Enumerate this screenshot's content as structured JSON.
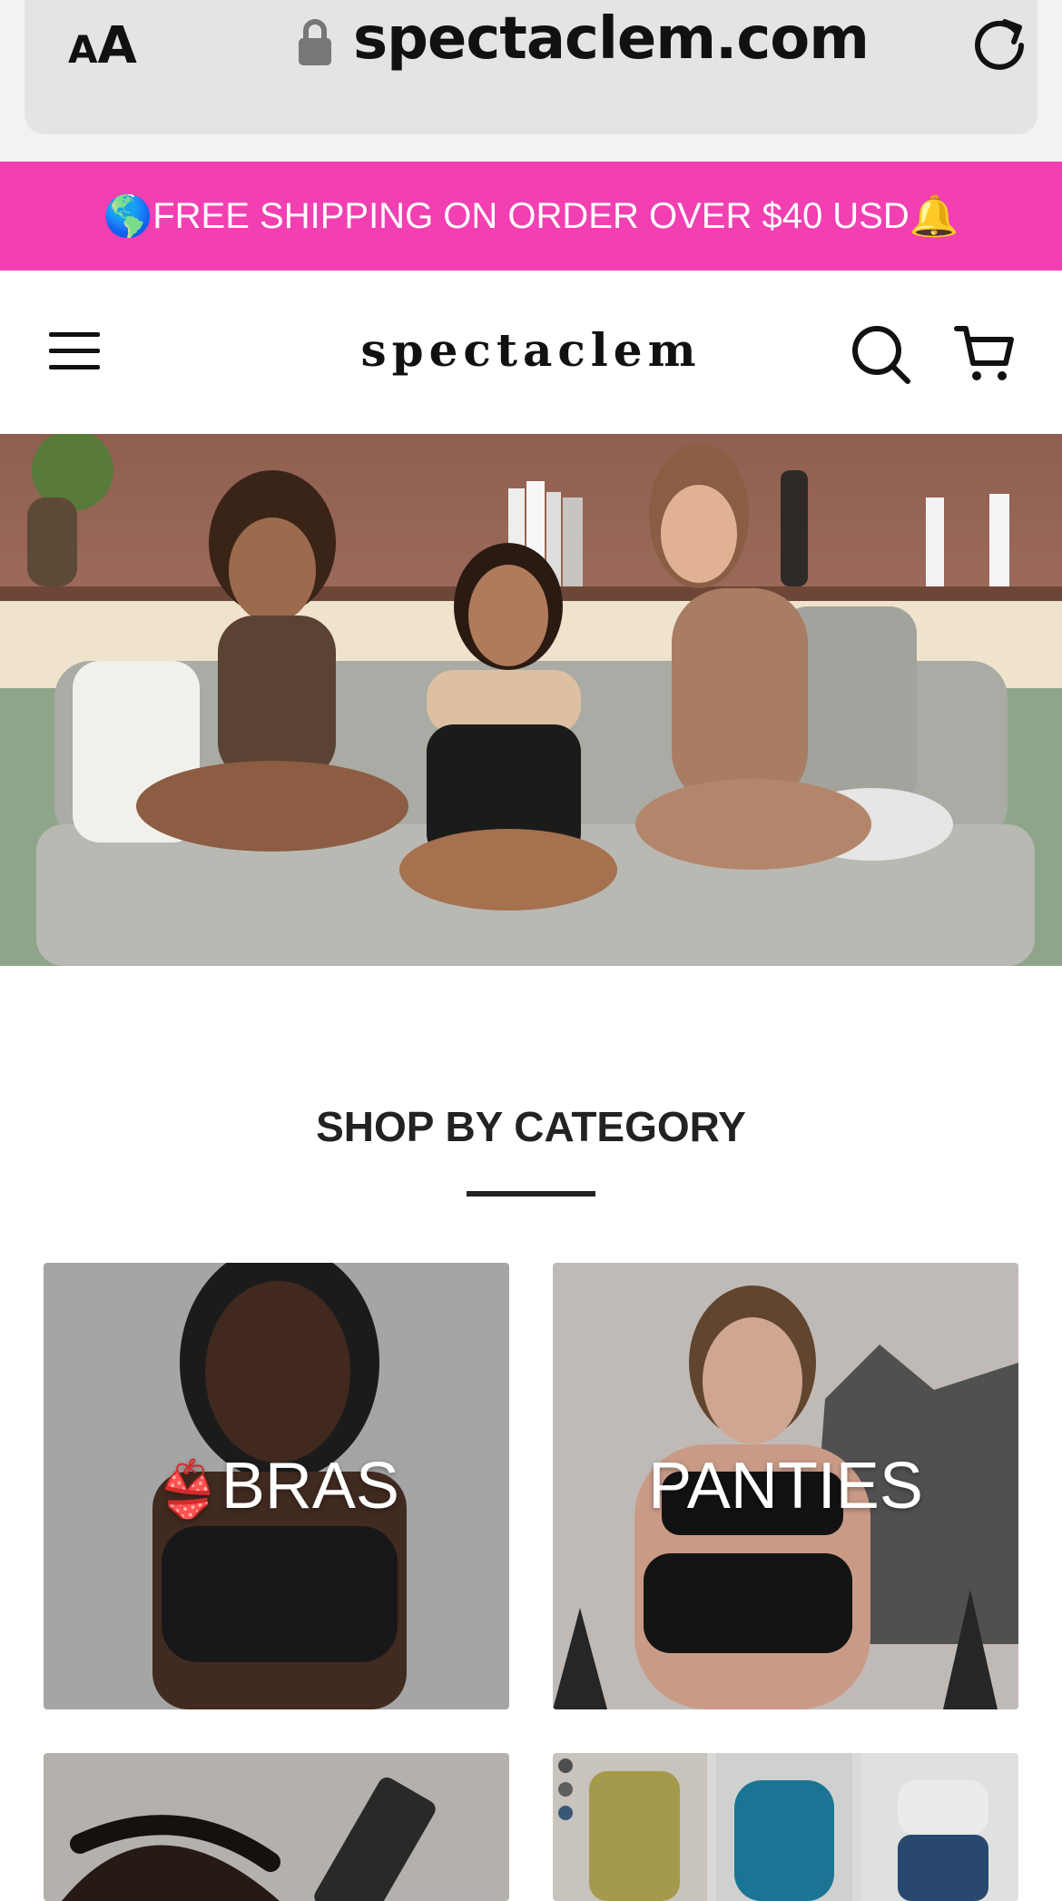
{
  "browser": {
    "text_size_label_small": "A",
    "text_size_label_big": "A",
    "url": "spectaclem.com"
  },
  "promo": {
    "text": "FREE SHIPPING ON ORDER OVER $40 USD",
    "emoji_left": "🌎",
    "emoji_right": "🔔",
    "background": "#f23fb2"
  },
  "header": {
    "logo": "spectaclem",
    "icons": [
      "menu-icon",
      "search-icon",
      "cart-icon"
    ]
  },
  "section": {
    "title": "SHOP BY CATEGORY"
  },
  "categories": [
    {
      "label": "BRAS",
      "emoji": "👙"
    },
    {
      "label": "PANTIES"
    },
    {
      "label": ""
    },
    {
      "label": ""
    }
  ]
}
